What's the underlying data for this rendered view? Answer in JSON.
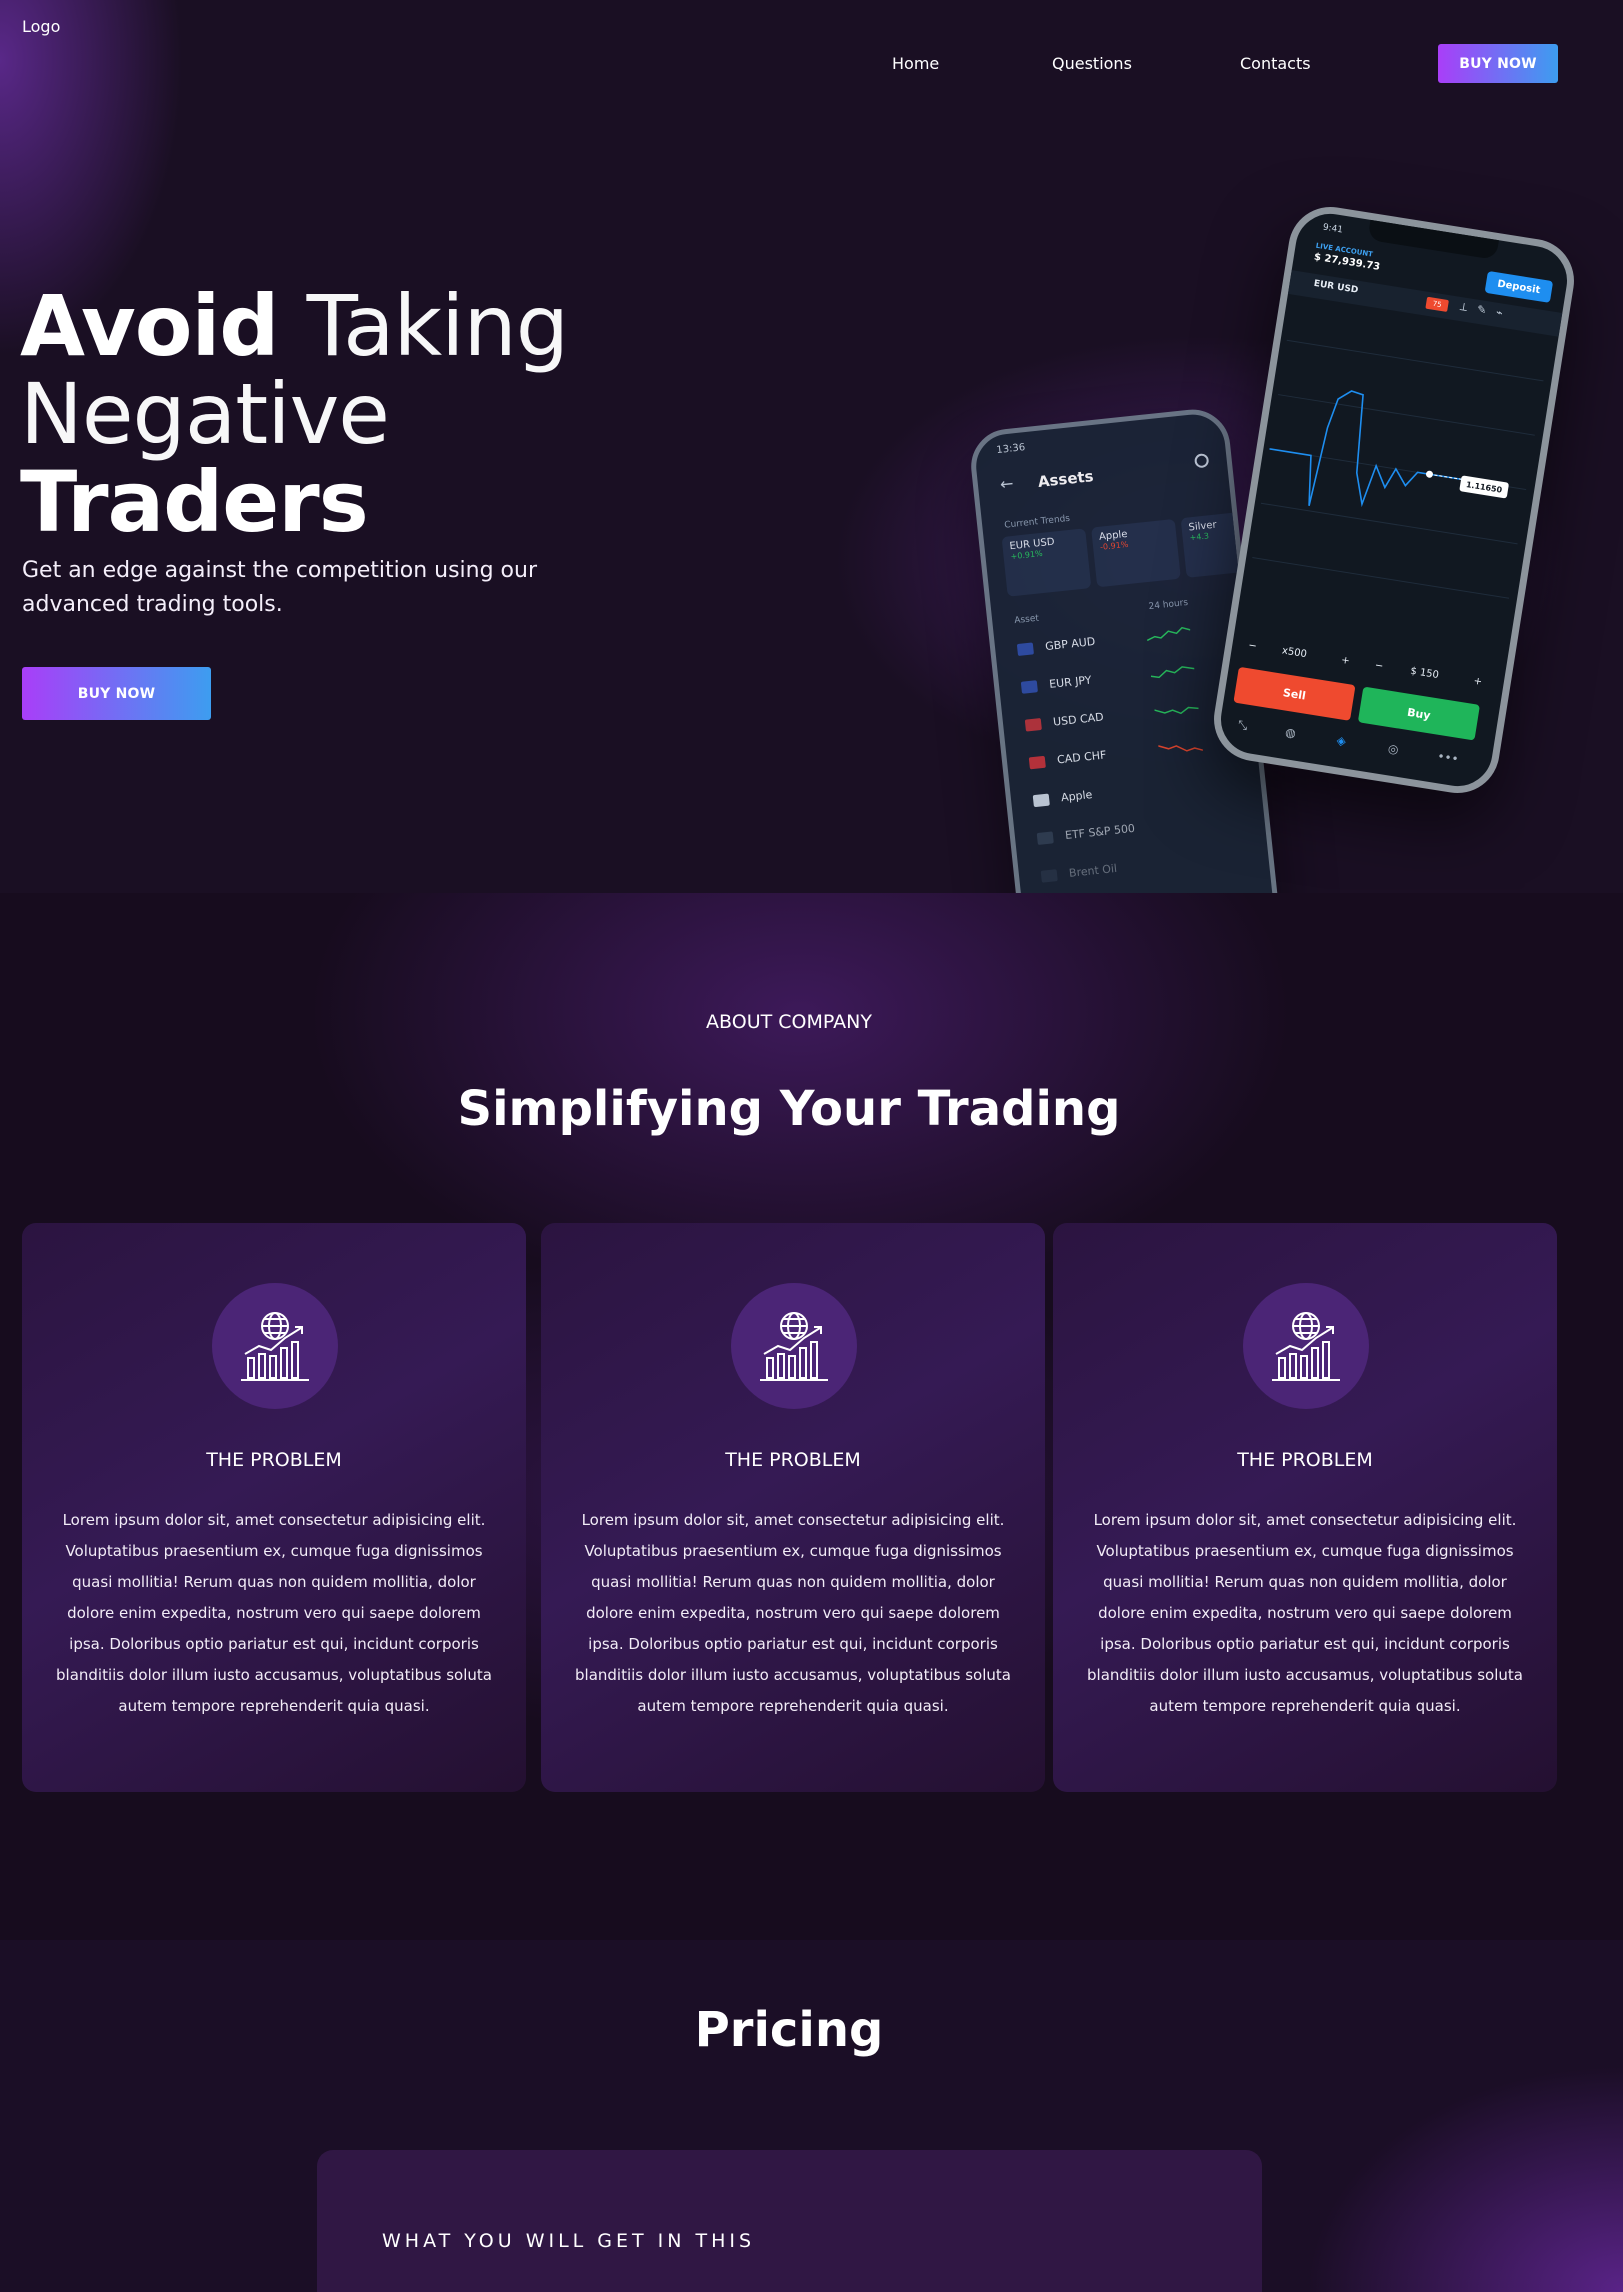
{
  "header": {
    "logo": "Logo",
    "nav": [
      "Home",
      "Questions",
      "Contacts"
    ],
    "cta_label": "BUY NOW"
  },
  "hero": {
    "title_bold_1": "Avoid",
    "title_thin_1": "Taking",
    "title_thin_2": "Negative",
    "title_bold_2": "Traders",
    "subtitle_line_1": "Get an edge against the competition using our",
    "subtitle_line_2": "advanced trading tools.",
    "cta_label": "BUY NOW"
  },
  "phone_back": {
    "status_time": "13:36",
    "title": "Assets",
    "trends_label": "Current Trends",
    "trends": [
      {
        "name": "EUR USD",
        "change": "+0.91%",
        "color": "#27c75f"
      },
      {
        "name": "Apple",
        "change": "-0.91%",
        "color": "#ef4a2f"
      },
      {
        "name": "Silver",
        "change": "+4.3",
        "color": "#27c75f"
      }
    ],
    "list_header_left": "Asset",
    "list_header_right": "24 hours",
    "assets": [
      "GBP AUD",
      "EUR JPY",
      "USD CAD",
      "CAD CHF",
      "Apple",
      "ETF S&P 500",
      "Brent Oil"
    ]
  },
  "phone_front": {
    "status_time": "9:41",
    "account_label": "LIVE ACCOUNT",
    "balance": "$ 27,939.73",
    "deposit_label": "Deposit",
    "pair": "EUR USD",
    "badge": "75",
    "price_tag": "1.11650",
    "multiplier": "x500",
    "amount": "$ 150",
    "sell_label": "Sell",
    "buy_label": "Buy",
    "accent_color": "#1e8ef0"
  },
  "about": {
    "label": "ABOUT COMPANY",
    "title": "Simplifying Your Trading",
    "cards": [
      {
        "icon": "global-growth-icon",
        "title": "THE PROBLEM",
        "text": "Lorem ipsum dolor sit, amet consectetur adipisicing elit. Voluptatibus praesentium ex, cumque fuga dignissimos quasi mollitia! Rerum quas non quidem mollitia, dolor dolore enim expedita, nostrum vero qui saepe dolorem ipsa. Doloribus optio pariatur est qui, incidunt corporis blanditiis dolor illum iusto accusamus, voluptatibus soluta autem tempore reprehenderit quia quasi."
      },
      {
        "icon": "global-growth-icon",
        "title": "THE PROBLEM",
        "text": "Lorem ipsum dolor sit, amet consectetur adipisicing elit. Voluptatibus praesentium ex, cumque fuga dignissimos quasi mollitia! Rerum quas non quidem mollitia, dolor dolore enim expedita, nostrum vero qui saepe dolorem ipsa. Doloribus optio pariatur est qui, incidunt corporis blanditiis dolor illum iusto accusamus, voluptatibus soluta autem tempore reprehenderit quia quasi."
      },
      {
        "icon": "global-growth-icon",
        "title": "THE PROBLEM",
        "text": "Lorem ipsum dolor sit, amet consectetur adipisicing elit. Voluptatibus praesentium ex, cumque fuga dignissimos quasi mollitia! Rerum quas non quidem mollitia, dolor dolore enim expedita, nostrum vero qui saepe dolorem ipsa. Doloribus optio pariatur est qui, incidunt corporis blanditiis dolor illum iusto accusamus, voluptatibus soluta autem tempore reprehenderit quia quasi."
      }
    ]
  },
  "pricing": {
    "title": "Pricing",
    "card_title": "WHAT YOU WILL GET IN THIS"
  },
  "colors": {
    "cta_gradient_start": "#a93ef8",
    "cta_gradient_end": "#3d9df0",
    "background": "#170c1e",
    "icon_circle": "#4b2576"
  }
}
